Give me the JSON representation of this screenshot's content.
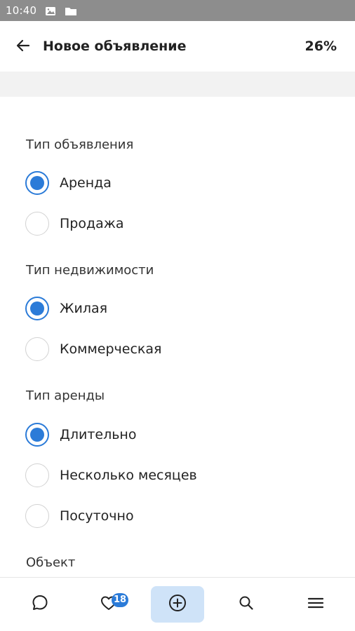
{
  "status_bar": {
    "time": "10:40",
    "icons": [
      "image-icon",
      "folder-icon"
    ]
  },
  "app_bar": {
    "back_icon": "arrow-left-icon",
    "title": "Новое объявление",
    "progress": "26%"
  },
  "form": {
    "groups": [
      {
        "label": "Тип объявления",
        "options": [
          {
            "label": "Аренда",
            "checked": true
          },
          {
            "label": "Продажа",
            "checked": false
          }
        ]
      },
      {
        "label": "Тип недвижимости",
        "options": [
          {
            "label": "Жилая",
            "checked": true
          },
          {
            "label": "Коммерческая",
            "checked": false
          }
        ]
      },
      {
        "label": "Тип аренды",
        "options": [
          {
            "label": "Длительно",
            "checked": true
          },
          {
            "label": "Несколько месяцев",
            "checked": false
          },
          {
            "label": "Посуточно",
            "checked": false
          }
        ]
      },
      {
        "label": "Объект",
        "options": []
      }
    ]
  },
  "bottom_nav": {
    "items": [
      {
        "icon": "chat-icon",
        "active": false
      },
      {
        "icon": "heart-icon",
        "badge": "18",
        "active": false
      },
      {
        "icon": "add-circle-icon",
        "active": true
      },
      {
        "icon": "search-icon",
        "active": false
      },
      {
        "icon": "menu-icon",
        "active": false
      }
    ]
  },
  "colors": {
    "accent": "#2b7bd8",
    "status_bar": "#8d8d8d",
    "active_nav_bg": "#cfe3f8",
    "band": "#f2f2f2"
  }
}
